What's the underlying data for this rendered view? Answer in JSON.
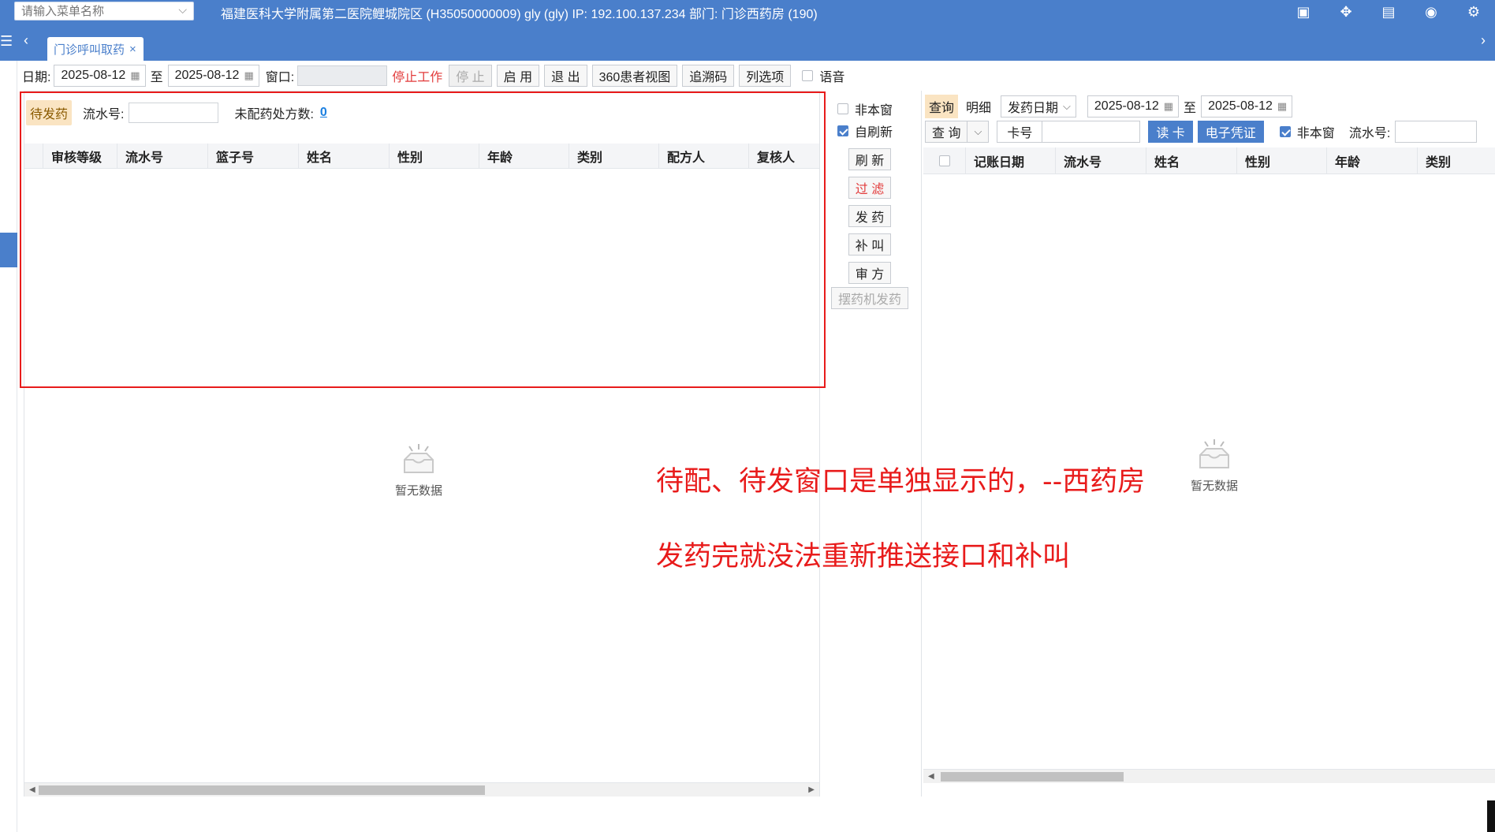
{
  "header": {
    "menu_search_placeholder": "请输入菜单名称",
    "info": "福建医科大学附属第二医院鲤城院区 (H35050000009) gly (gly) IP:  192.100.137.234 部门:  门诊西药房 (190)"
  },
  "tabs": [
    {
      "label": "门诊呼叫取药",
      "close": "×"
    }
  ],
  "toolbar": {
    "date_label": "日期:",
    "date_from": "2025-08-12",
    "to_label": "至",
    "date_to": "2025-08-12",
    "window_label": "窗口:",
    "stop_work": "停止工作",
    "stop": "停 止",
    "enable": "启 用",
    "exit": "退 出",
    "patient_view": "360患者视图",
    "trace_code": "追溯码",
    "column_options": "列选项",
    "voice": "语音"
  },
  "left_panel": {
    "pending_tag": "待发药",
    "flow_label": "流水号:",
    "unmatched_label": "未配药处方数:",
    "unmatched_count": "0",
    "columns": [
      "审核等级",
      "流水号",
      "篮子号",
      "姓名",
      "性别",
      "年龄",
      "类别",
      "配方人",
      "复核人"
    ],
    "empty_text": "暂无数据"
  },
  "middle": {
    "not_this_window": "非本窗",
    "auto_refresh": "自刷新",
    "auto_refresh_checked": true,
    "not_this_window_checked": false,
    "refresh": "刷 新",
    "filter": "过 滤",
    "dispense": "发 药",
    "recall": "补 叫",
    "review": "审 方",
    "machine_dispense": "摆药机发药"
  },
  "right_panel": {
    "query_tag": "查询",
    "detail_tab": "明细",
    "date_type": "发药日期",
    "date_from": "2025-08-12",
    "to_label": "至",
    "date_to": "2025-08-12",
    "query_btn": "查 询",
    "card_label": "卡号",
    "read_card": "读 卡",
    "e_voucher": "电子凭证",
    "not_this_window": "非本窗",
    "not_this_window_checked": true,
    "flow_label": "流水号:",
    "columns": [
      "记账日期",
      "流水号",
      "姓名",
      "性别",
      "年龄",
      "类别"
    ],
    "empty_text": "暂无数据"
  },
  "annotations": {
    "line1": "待配、待发窗口是单独显示的，--西药房",
    "line2": "发药完就没法重新推送接口和补叫",
    "color": "#e81b1b"
  },
  "colors": {
    "brand_blue": "#4a7fcb",
    "highlight_box": "#e81b1b",
    "tag_bg": "#fae4c2"
  }
}
